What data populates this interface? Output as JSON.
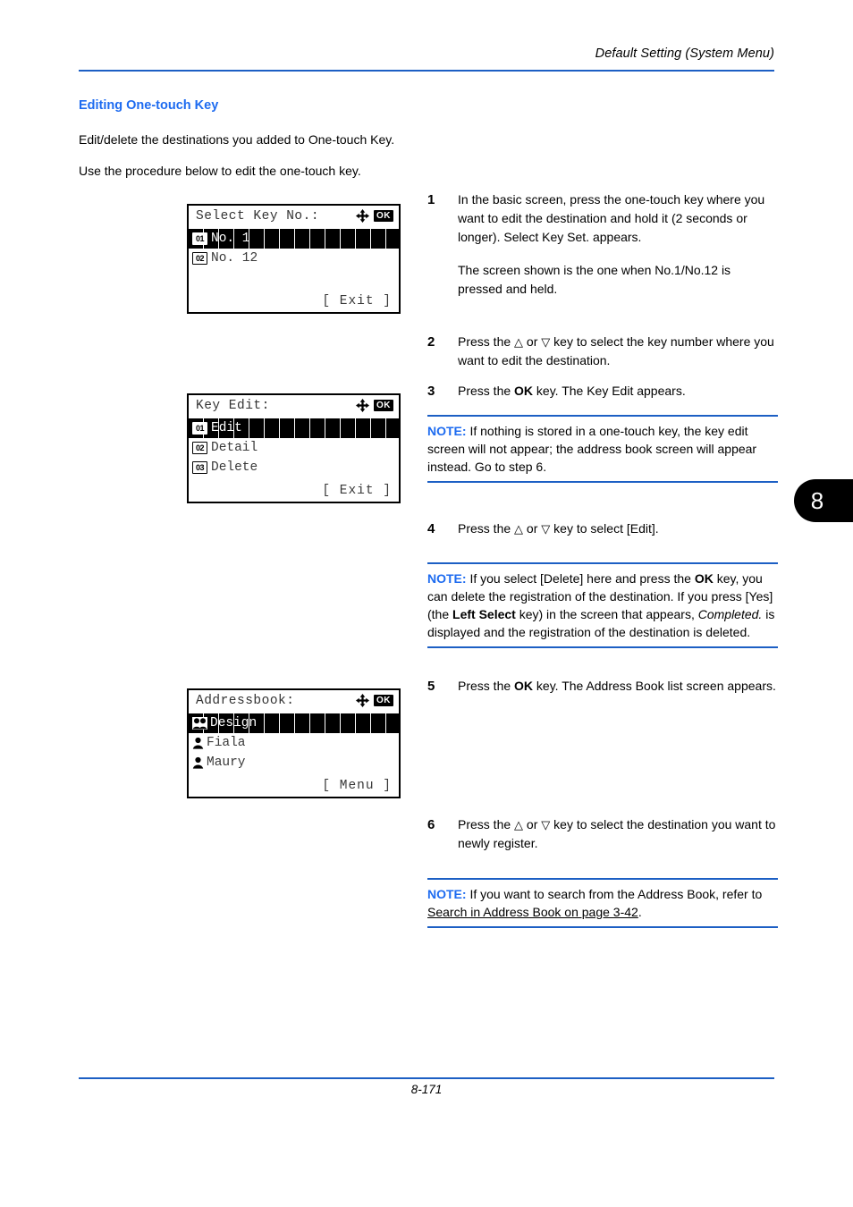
{
  "header": {
    "running_title": "Default Setting (System Menu)"
  },
  "footer": {
    "page_number": "8-171"
  },
  "chapter_tab": {
    "number": "8"
  },
  "section": {
    "title": "Editing One-touch Key",
    "intro_1": "Edit/delete the destinations you added to One-touch Key.",
    "intro_2": "Use the procedure below to edit the one-touch key."
  },
  "screens": [
    {
      "name": "select-key-no",
      "title": "Select Key No.:",
      "nav_icon": "four-way-arrow-icon",
      "ok_label": "OK",
      "rows": [
        {
          "badge": "01",
          "label": "No. 1",
          "selected": true
        },
        {
          "badge": "02",
          "label": "No. 12",
          "selected": false
        }
      ],
      "softkey": "[  Exit   ]"
    },
    {
      "name": "key-edit",
      "title": "Key Edit:",
      "nav_icon": "four-way-arrow-icon",
      "ok_label": "OK",
      "rows": [
        {
          "badge": "01",
          "label": "Edit",
          "selected": true
        },
        {
          "badge": "02",
          "label": "Detail",
          "selected": false
        },
        {
          "badge": "03",
          "label": "Delete",
          "selected": false
        }
      ],
      "softkey": "[  Exit   ]"
    },
    {
      "name": "addressbook",
      "title": "Addressbook:",
      "nav_icon": "four-way-arrow-icon",
      "ok_label": "OK",
      "rows": [
        {
          "icon": "group-icon",
          "label": "Design",
          "selected": true
        },
        {
          "icon": "person-icon",
          "label": "Fiala",
          "selected": false
        },
        {
          "icon": "person-icon",
          "label": "Maury",
          "selected": false
        }
      ],
      "softkey": "[  Menu   ]"
    }
  ],
  "steps": [
    {
      "num": "1",
      "p1": "In the basic screen, press the one-touch key where you want to edit the destination and hold it (2 seconds or longer). Select Key Set. appears.",
      "p2": "The screen shown is the one when No.1/No.12 is pressed and held."
    },
    {
      "num": "2",
      "p1_pre": "Press the ",
      "p1_up": "△",
      "p1_mid": " or ",
      "p1_down": "▽",
      "p1_post": " key to select the key number where you want to edit the destination."
    },
    {
      "num": "3",
      "p1_pre": "Press the ",
      "p1_bold": "OK",
      "p1_post": " key. The Key Edit appears."
    },
    {
      "num": "4",
      "p1_pre": "Press the ",
      "p1_up": "△",
      "p1_mid": " or ",
      "p1_down": "▽",
      "p1_post": " key to select [Edit]."
    },
    {
      "num": "5",
      "p1_pre": "Press the ",
      "p1_bold": "OK",
      "p1_post": " key. The Address Book list screen appears."
    },
    {
      "num": "6",
      "p1_pre": "Press the ",
      "p1_up": "△",
      "p1_mid": " or ",
      "p1_down": "▽",
      "p1_post": " key to select the destination you want to newly register."
    }
  ],
  "notes": [
    {
      "label": "NOTE:",
      "text": " If nothing is stored in a one-touch key, the key edit screen will not appear; the address book screen will appear instead. Go to step 6."
    },
    {
      "label": "NOTE:",
      "t1": " If you select [Delete] here and press the ",
      "b1": "OK",
      "t2": " key, you can delete the registration of the destination. If you press [Yes] (the ",
      "b2": "Left Select",
      "t3": " key) in the screen that appears, ",
      "i1": "Completed.",
      "t4": " is displayed and the registration of the destination is deleted."
    },
    {
      "label": "NOTE:",
      "t1": "  If you want to search from the Address Book, refer to ",
      "link": "Search in Address Book on page 3-42",
      "t2": "."
    }
  ],
  "colors": {
    "accent_blue": "#1d6bf0",
    "rule_blue": "#1c5fc4",
    "lcd_text": "#3a3a3a"
  }
}
